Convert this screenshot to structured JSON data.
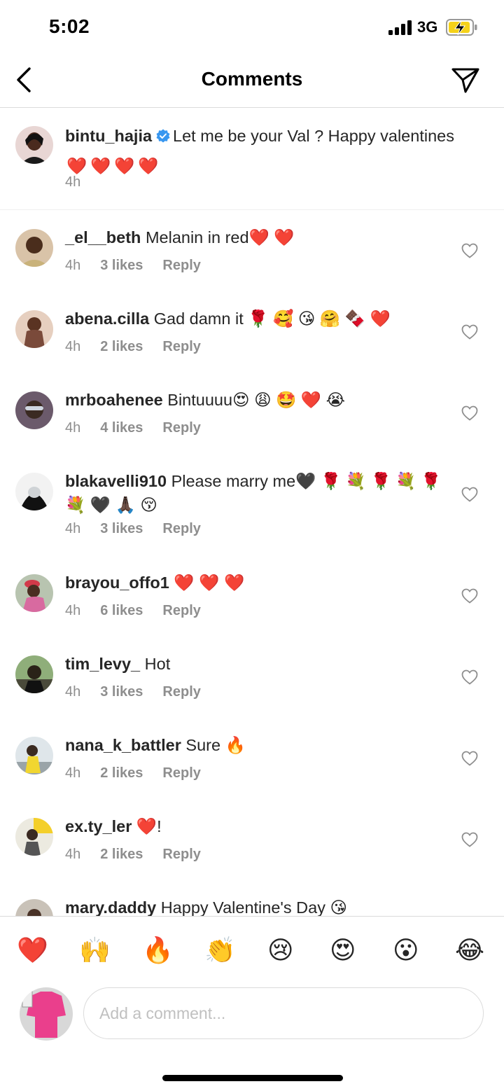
{
  "status_bar": {
    "time": "5:02",
    "network": "3G",
    "battery_color": "#f5d21a"
  },
  "header": {
    "title": "Comments",
    "back_icon": "chevron-left-icon",
    "share_icon": "paper-plane-icon"
  },
  "caption": {
    "username": "bintu_hajia",
    "verified": true,
    "text": "Let me be your Val ? Happy valentines",
    "emojis": [
      "❤️",
      "❤️",
      "❤️",
      "❤️"
    ],
    "time": "4h"
  },
  "comments": [
    {
      "username": "_el__beth",
      "text": "Melanin in red❤️ ❤️",
      "time": "4h",
      "likes": "3 likes",
      "reply": "Reply"
    },
    {
      "username": "abena.cilla",
      "text": "Gad damn it 🌹 🥰 😘 🤗 🍫 ❤️",
      "time": "4h",
      "likes": "2 likes",
      "reply": "Reply"
    },
    {
      "username": "mrboahenee",
      "text": "Bintuuuu😍 😩 🤩 ❤️ 😭",
      "time": "4h",
      "likes": "4 likes",
      "reply": "Reply"
    },
    {
      "username": "blakavelli910",
      "text": "Please marry me🖤 🌹 💐 🌹 💐 🌹 💐 🖤 🙏🏿 😚",
      "time": "4h",
      "likes": "3 likes",
      "reply": "Reply"
    },
    {
      "username": "brayou_offo1",
      "text": "❤️ ❤️ ❤️",
      "time": "4h",
      "likes": "6 likes",
      "reply": "Reply"
    },
    {
      "username": "tim_levy_",
      "text": "Hot",
      "time": "4h",
      "likes": "3 likes",
      "reply": "Reply"
    },
    {
      "username": "nana_k_battler",
      "text": "Sure 🔥",
      "time": "4h",
      "likes": "2 likes",
      "reply": "Reply"
    },
    {
      "username": "ex.ty_ler",
      "text": "❤️!",
      "time": "4h",
      "likes": "2 likes",
      "reply": "Reply"
    },
    {
      "username": "mary.daddy",
      "text": "Happy Valentine's Day 😘",
      "time": "",
      "likes": "",
      "reply": ""
    }
  ],
  "reactions": [
    "❤️",
    "🙌",
    "🔥",
    "👏",
    "😢",
    "😍",
    "😮",
    "😂"
  ],
  "composer": {
    "placeholder": "Add a comment..."
  },
  "colors": {
    "muted": "#8e8e8e",
    "text": "#262626",
    "verified": "#3897f0",
    "divider": "#dbdbdb"
  }
}
